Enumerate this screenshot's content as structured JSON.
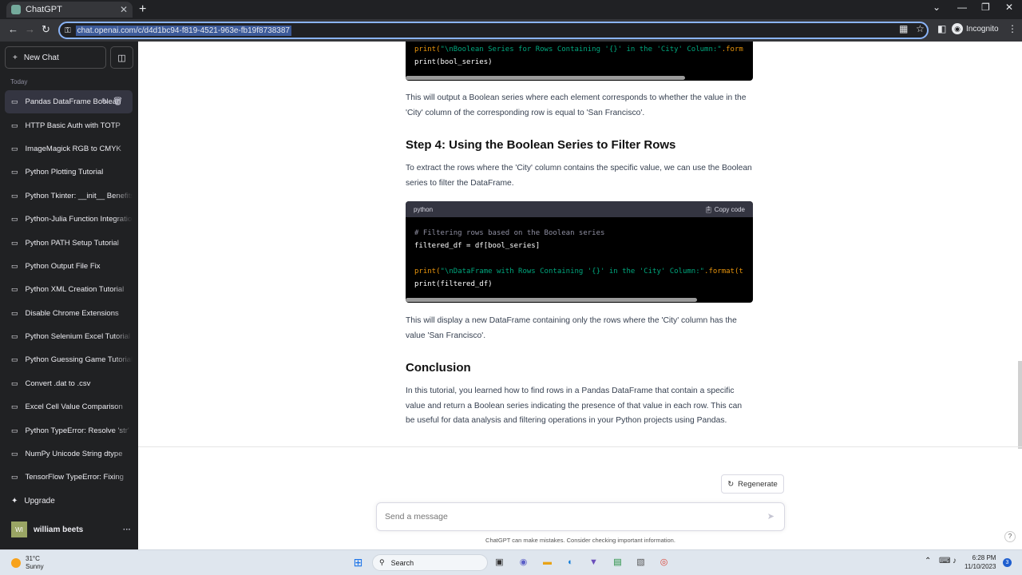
{
  "browser": {
    "tab_title": "ChatGPT",
    "url": "chat.openai.com/c/d4d1bc94-f819-4521-963e-fb19f8738387",
    "profile": "Incognito"
  },
  "sidebar": {
    "new_chat": "New Chat",
    "section": "Today",
    "items": [
      "Pandas DataFrame Boolean",
      "HTTP Basic Auth with TOTP",
      "ImageMagick RGB to CMYK",
      "Python Plotting Tutorial",
      "Python Tkinter: __init__ Benefits",
      "Python-Julia Function Integration",
      "Python PATH Setup Tutorial",
      "Python Output File Fix",
      "Python XML Creation Tutorial",
      "Disable Chrome Extensions",
      "Python Selenium Excel Tutorial",
      "Python Guessing Game Tutorial",
      "Convert .dat to .csv",
      "Excel Cell Value Comparison",
      "Python TypeError: Resolve 'str'",
      "NumPy Unicode String dtype",
      "TensorFlow TypeError: Fixing"
    ],
    "upgrade": "Upgrade",
    "user_initials": "WI",
    "user_name": "william beets"
  },
  "chat": {
    "code1": {
      "line1_fn": "print(",
      "line1_str": "\"\\nBoolean Series for Rows Containing '{}' in the 'City' Column:\"",
      "line1_tail": ".form",
      "line2": "print(bool_series)"
    },
    "para1": "This will output a Boolean series where each element corresponds to whether the value in the 'City' column of the corresponding row is equal to 'San Francisco'.",
    "heading1": "Step 4: Using the Boolean Series to Filter Rows",
    "para2": "To extract the rows where the 'City' column contains the specific value, we can use the Boolean series to filter the DataFrame.",
    "code2": {
      "lang": "python",
      "copy": "Copy code",
      "comment": "# Filtering rows based on the Boolean series",
      "line2": "filtered_df = df[bool_series]",
      "line3_fn": "print(",
      "line3_str": "\"\\nDataFrame with Rows Containing '{}' in the 'City' Column:\"",
      "line3_tail": ".format(t",
      "line4": "print(filtered_df)"
    },
    "para3": "This will display a new DataFrame containing only the rows where the 'City' column has the value 'San Francisco'.",
    "heading2": "Conclusion",
    "para4": "In this tutorial, you learned how to find rows in a Pandas DataFrame that contain a specific value and return a Boolean series indicating the presence of that value in each row. This can be useful for data analysis and filtering operations in your Python projects using Pandas."
  },
  "composer": {
    "regenerate": "Regenerate",
    "placeholder": "Send a message",
    "disclaimer": "ChatGPT can make mistakes. Consider checking important information."
  },
  "taskbar": {
    "temp": "31°C",
    "condition": "Sunny",
    "search": "Search",
    "time": "6:28 PM",
    "date": "11/10/2023",
    "notifications": "3"
  }
}
